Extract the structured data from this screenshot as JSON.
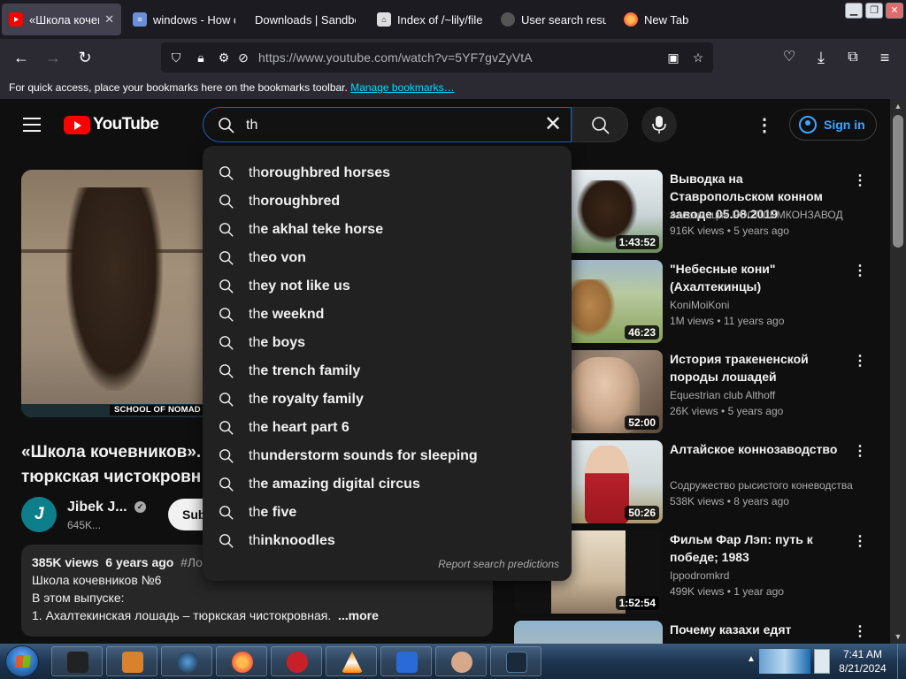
{
  "browser": {
    "tabs": [
      {
        "title": "«Школа кочевников»",
        "icon": "youtube-icon",
        "active": true
      },
      {
        "title": "windows - How do",
        "icon": "stack-icon"
      },
      {
        "title": "Downloads | Sandbox",
        "icon": ""
      },
      {
        "title": "Index of /~lily/file",
        "icon": "github-icon"
      },
      {
        "title": "User search result",
        "icon": "globe-icon"
      },
      {
        "title": "New Tab",
        "icon": "firefox-icon"
      }
    ],
    "url": "https://www.youtube.com/watch?v=5YF7gvZyVtA",
    "bookmarks_text": "For quick access, place your bookmarks here on the bookmarks toolbar.",
    "bookmarks_link": "Manage bookmarks…"
  },
  "youtube": {
    "logo_text": "YouTube",
    "search_query": "th",
    "sign_in": "Sign in",
    "suggestions": [
      {
        "prefix": "th",
        "rest": "oroughbred horses"
      },
      {
        "prefix": "th",
        "rest": "oroughbred"
      },
      {
        "prefix": "th",
        "rest": "e akhal teke horse"
      },
      {
        "prefix": "th",
        "rest": "eo von"
      },
      {
        "prefix": "th",
        "rest": "ey not like us"
      },
      {
        "prefix": "th",
        "rest": "e weeknd"
      },
      {
        "prefix": "th",
        "rest": "e boys"
      },
      {
        "prefix": "th",
        "rest": "e trench family"
      },
      {
        "prefix": "th",
        "rest": "e royalty family"
      },
      {
        "prefix": "th",
        "rest": "e heart part 6"
      },
      {
        "prefix": "th",
        "rest": "understorm sounds for sleeping"
      },
      {
        "prefix": "th",
        "rest": "e amazing digital circus"
      },
      {
        "prefix": "th",
        "rest": "e five"
      },
      {
        "prefix": "th",
        "rest": "inknoodles"
      }
    ],
    "report_text": "Report search predictions",
    "player": {
      "lower_third": "SCHOOL OF NOMAD"
    },
    "video": {
      "title_line1": "«Школа кочевников».",
      "title_line2": "тюркская чистокровн",
      "channel": "Jibek J...",
      "subscribers": "645K...",
      "subscribe_label": "Subscribe",
      "views": "385K views",
      "age": "6 years ago",
      "tag": "#Лош",
      "desc_line1": "Школа кочевников №6",
      "desc_line2": "В этом выпуске:",
      "desc_line3": "1. Ахалтекинская лошадь – тюркская чистокровная.",
      "more": "...more"
    },
    "related": [
      {
        "title": "Выводка на Ставропольском конном заводе 05.08.2019",
        "channel": "Ассоциация РОСПЛЕМКОНЗАВОД",
        "views": "916K views",
        "age": "5 years ago",
        "duration": "1:43:52"
      },
      {
        "title": "\"Небесные кони\" (Ахалтекинцы)",
        "channel": "KoniMoiKoni",
        "views": "1M views",
        "age": "11 years ago",
        "duration": "46:23"
      },
      {
        "title": "История тракененской породы лошадей",
        "channel": "Equestrian club Althoff",
        "views": "26K views",
        "age": "5 years ago",
        "duration": "52:00"
      },
      {
        "title": "Алтайское коннозаводство",
        "channel": "Содружество рысистого коневодства",
        "views": "538K views",
        "age": "8 years ago",
        "duration": "50:26"
      },
      {
        "title": "Фильм Фар Лэп: путь к победе; 1983",
        "channel": "Ippodromkrd",
        "views": "499K views",
        "age": "1 year ago",
        "duration": "1:52:54"
      },
      {
        "title": "Почему казахи едят",
        "channel": "",
        "views": "",
        "age": "",
        "duration": ""
      }
    ]
  },
  "taskbar": {
    "time": "7:41 AM",
    "date": "8/21/2024"
  }
}
